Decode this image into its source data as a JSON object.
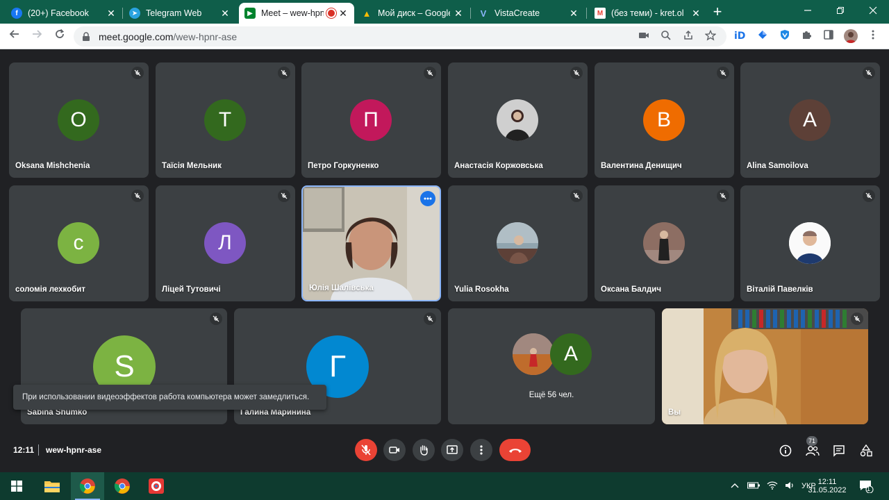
{
  "browser": {
    "tabs": [
      {
        "title": "(20+) Facebook",
        "fav_letter": "f",
        "fav_color": "#1877f2"
      },
      {
        "title": "Telegram Web",
        "fav_letter": "➤",
        "fav_color": "#2aa3e0"
      },
      {
        "title": "Meet – wew-hpnr-ase",
        "fav_letter": "▶",
        "fav_color": "#00832d",
        "active": true
      },
      {
        "title": "Мой диск – Google",
        "fav_letter": "▲",
        "fav_color": "#fbbc04"
      },
      {
        "title": "VistaCreate",
        "fav_letter": "V",
        "fav_color": "#1565c0"
      },
      {
        "title": "(без теми) - kret.ol",
        "fav_letter": "M",
        "fav_color": "#ea4335"
      }
    ],
    "close_glyph": "✕",
    "new_tab_glyph": "+",
    "url_host": "meet.google.com",
    "url_path": "/wew-hpnr-ase"
  },
  "meet": {
    "participants_row1": [
      {
        "name": "Oksana Mishchenia",
        "initial": "O",
        "color": "#33691e"
      },
      {
        "name": "Таїсія Мельник",
        "initial": "Т",
        "color": "#33691e"
      },
      {
        "name": "Петро Горкуненко",
        "initial": "П",
        "color": "#c2185b"
      },
      {
        "name": "Анастасія Коржовська",
        "initial": "",
        "photo": true
      },
      {
        "name": "Валентина Денищич",
        "initial": "В",
        "color": "#ef6c00"
      },
      {
        "name": "Alina Samoilova",
        "initial": "A",
        "color": "#5d4037"
      }
    ],
    "participants_row2": [
      {
        "name": "соломія лехкобит",
        "initial": "с",
        "color": "#7cb342"
      },
      {
        "name": "Ліцей Тутовичі",
        "initial": "Л",
        "color": "#7e57c2"
      },
      {
        "name": "Юлія Шалівська",
        "initial": "",
        "video": true
      },
      {
        "name": "Yulia Rosokha",
        "initial": "",
        "photo": true
      },
      {
        "name": "Оксана Балдич",
        "initial": "",
        "photo": true
      },
      {
        "name": "Віталій Павелків",
        "initial": "",
        "photo": true
      }
    ],
    "participants_row3": [
      {
        "name": "Sabina Shumko",
        "initial": "S",
        "color": "#7cb342"
      },
      {
        "name": "Галина Маринина",
        "initial": "Г",
        "color": "#0288d1"
      }
    ],
    "more_tile": {
      "label": "Ещё 56 чел.",
      "initial": "A",
      "color": "#33691e"
    },
    "self_tile": {
      "name": "Вы"
    },
    "toast": "При использовании видеоэффектов работа компьютера может замедлиться.",
    "clock": "12:11",
    "meeting_code": "wew-hpnr-ase",
    "participant_count": "71"
  },
  "taskbar": {
    "language": "УКР",
    "time": "12:11",
    "date": "31.05.2022",
    "notif_count": "1"
  }
}
